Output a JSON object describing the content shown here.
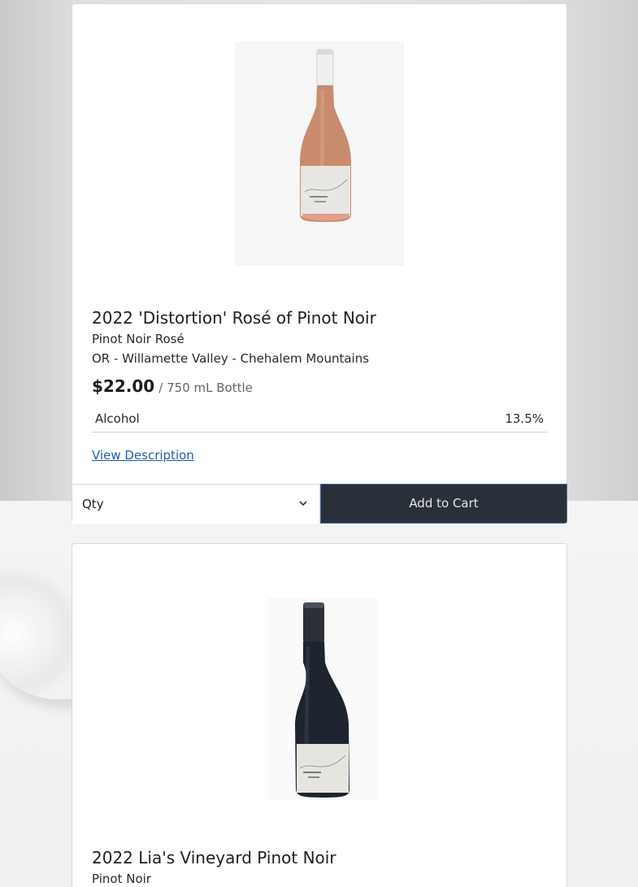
{
  "products": [
    {
      "title": "2022 'Distortion' Rosé of Pinot Noir",
      "varietal": "Pinot Noir Rosé",
      "region": "OR - Willamette Valley - Chehalem Mountains",
      "price": "$22.00",
      "unit": "/ 750 mL Bottle",
      "attribute_label": "Alcohol",
      "attribute_value": "13.5%",
      "view_description": "View Description",
      "qty_label": "Qty",
      "add_to_cart": "Add to Cart",
      "bottle_color": "#c98b6e"
    },
    {
      "title": "2022 Lia's Vineyard Pinot Noir",
      "varietal": "Pinot Noir",
      "bottle_color": "#1e2330"
    }
  ],
  "colors": {
    "button_bg": "#293039",
    "link": "#1f5fa8"
  }
}
